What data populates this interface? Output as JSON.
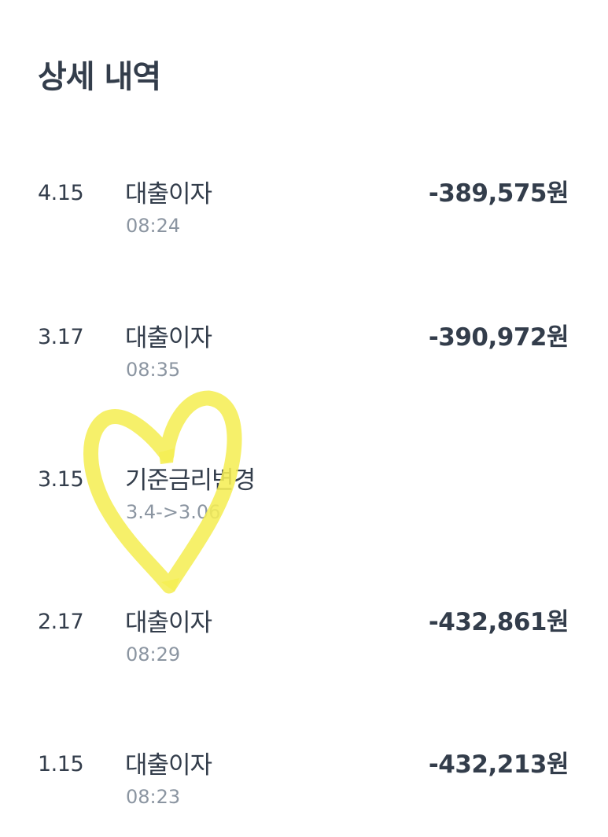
{
  "header": {
    "title": "상세 내역"
  },
  "transactions": [
    {
      "date": "4.15",
      "title": "대출이자",
      "subtitle": "08:24",
      "amount": "-389,575원"
    },
    {
      "date": "3.17",
      "title": "대출이자",
      "subtitle": "08:35",
      "amount": "-390,972원"
    },
    {
      "date": "3.15",
      "title": "기준금리변경",
      "subtitle": "3.4->3.06",
      "amount": ""
    },
    {
      "date": "2.17",
      "title": "대출이자",
      "subtitle": "08:29",
      "amount": "-432,861원"
    },
    {
      "date": "1.15",
      "title": "대출이자",
      "subtitle": "08:23",
      "amount": "-432,213원"
    }
  ],
  "annotation": {
    "shape": "heart-doodle",
    "color": "#f5ee55"
  }
}
